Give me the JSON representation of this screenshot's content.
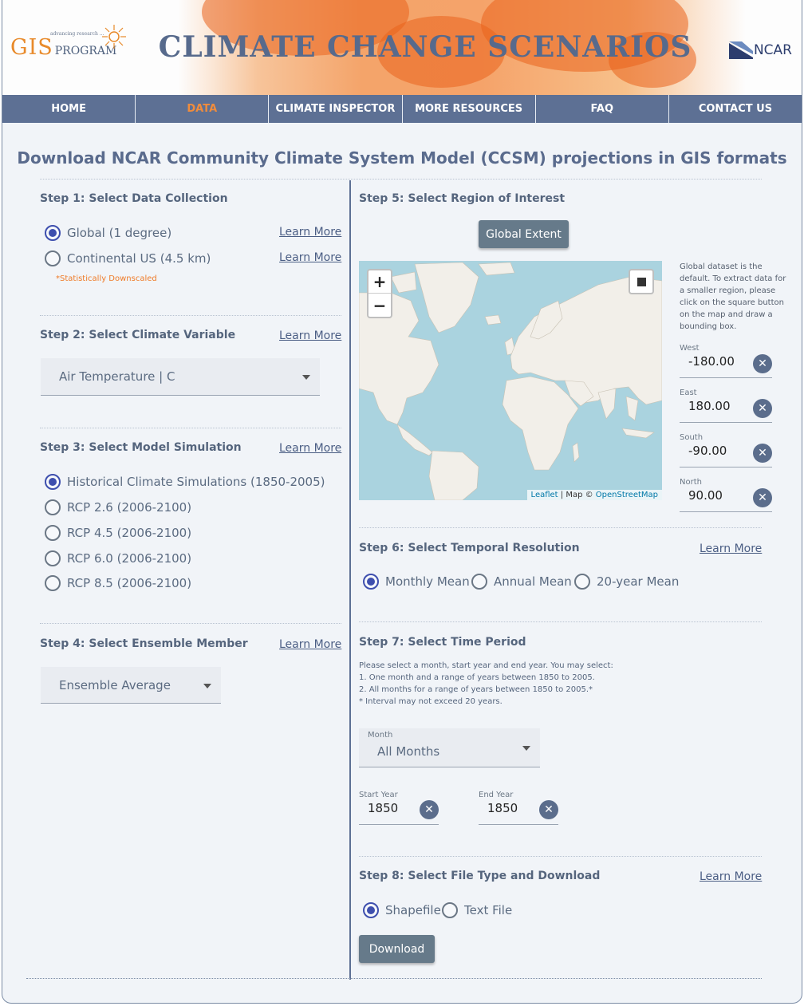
{
  "header": {
    "logo_gis": "GIS",
    "logo_program": "PROGRAM",
    "site_title": "CLIMATE CHANGE SCENARIOS",
    "partner_logo": "NCAR"
  },
  "nav": [
    "HOME",
    "DATA",
    "CLIMATE INSPECTOR",
    "MORE RESOURCES",
    "FAQ",
    "CONTACT US"
  ],
  "nav_active": "DATA",
  "page_title": "Download NCAR Community Climate System Model (CCSM) projections in GIS formats",
  "learn_more": "Learn More",
  "step1": {
    "heading": "Step 1: Select Data Collection",
    "options": [
      "Global (1 degree)",
      "Continental US (4.5 km)"
    ],
    "selected": "Global (1 degree)",
    "note": "*Statistically Downscaled"
  },
  "step2": {
    "heading": "Step 2: Select Climate Variable",
    "value": "Air Temperature | C"
  },
  "step3": {
    "heading": "Step 3: Select Model Simulation",
    "options": [
      "Historical Climate Simulations (1850-2005)",
      "RCP 2.6 (2006-2100)",
      "RCP 4.5 (2006-2100)",
      "RCP 6.0 (2006-2100)",
      "RCP 8.5 (2006-2100)"
    ],
    "selected": "Historical Climate Simulations (1850-2005)"
  },
  "step4": {
    "heading": "Step 4: Select Ensemble Member",
    "value": "Ensemble Average"
  },
  "step5": {
    "heading": "Step 5: Select Region of Interest",
    "global_button": "Global Extent",
    "note": "Global dataset is the default. To extract data for a smaller region, please click on the square button on the map and draw a bounding box.",
    "zoom_in": "+",
    "zoom_out": "−",
    "attribution": {
      "leaflet": "Leaflet",
      "sep": " | Map © ",
      "osm": "OpenStreetMap"
    },
    "bounds": [
      {
        "label": "West",
        "value": "-180.00"
      },
      {
        "label": "East",
        "value": "180.00"
      },
      {
        "label": "South",
        "value": "-90.00"
      },
      {
        "label": "North",
        "value": "90.00"
      }
    ]
  },
  "step6": {
    "heading": "Step 6: Select Temporal Resolution",
    "options": [
      "Monthly Mean",
      "Annual Mean",
      "20-year Mean"
    ],
    "selected": "Monthly Mean"
  },
  "step7": {
    "heading": "Step 7: Select Time Period",
    "info": [
      "Please select a month, start year and end year. You may select:",
      "1. One month and a range of years between 1850 to 2005.",
      "2. All months for a range of years between 1850 to 2005.*",
      "* Interval may not exceed 20 years."
    ],
    "month_label": "Month",
    "month_value": "All Months",
    "start_label": "Start Year",
    "start_value": "1850",
    "end_label": "End Year",
    "end_value": "1850"
  },
  "step8": {
    "heading": "Step 8: Select File Type and Download",
    "options": [
      "Shapefile",
      "Text File"
    ],
    "selected": "Shapefile",
    "download": "Download"
  },
  "colors": {
    "nav_bg": "#5d7094",
    "nav_active": "#f08c3c",
    "radio_selected": "#3e4fae",
    "button": "#667a8a",
    "ocean": "#aad3df",
    "land": "#f2efe9"
  }
}
